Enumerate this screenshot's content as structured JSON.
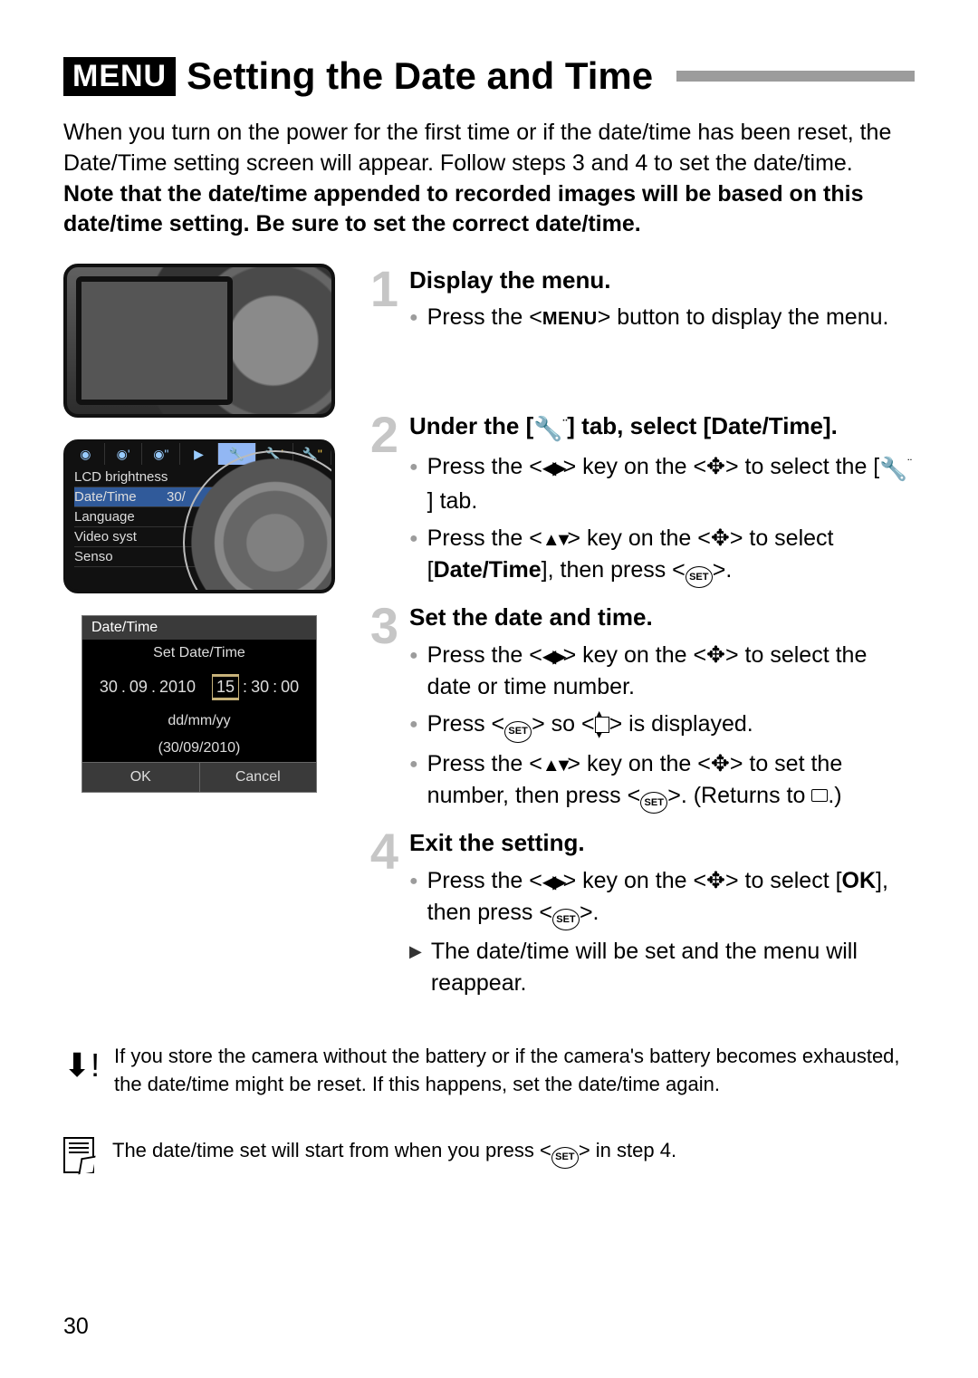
{
  "header": {
    "menu_badge": "MENU",
    "title": "Setting the Date and Time"
  },
  "intro": {
    "p1": "When you turn on the power for the first time or if the date/time has been reset, the Date/Time setting screen will appear. Follow steps 3 and 4 to set the date/time.",
    "p2_bold": "Note that the date/time appended to recorded images will be based on this date/time setting. Be sure to set the correct date/time."
  },
  "menu_thumb": {
    "lcd": "LCD brightness",
    "datetime": "Date/Time",
    "datetime_val": "30/",
    "language": "Language",
    "video": "Video syst",
    "sensor": "Senso"
  },
  "datetime_thumb": {
    "header": "Date/Time",
    "set_label": "Set Date/Time",
    "d": "30",
    "m": "09",
    "y": "2010",
    "h": "15",
    "min": "30",
    "s": "00",
    "format": "dd/mm/yy",
    "paren": "(30/09/2010)",
    "ok": "OK",
    "cancel": "Cancel"
  },
  "steps": {
    "s1": {
      "num": "1",
      "title": "Display the menu.",
      "b1a": "Press the <",
      "b1_menu": "MENU",
      "b1b": "> button to display the menu."
    },
    "s2": {
      "num": "2",
      "title_a": "Under the [",
      "title_b": "] tab, select [Date/Time].",
      "b1a": "Press the <",
      "b1b": "> key on the <",
      "b1c": "> to select the [",
      "b1d": "] tab.",
      "b2a": "Press the <",
      "b2b": "> key on the <",
      "b2c": "> to select [",
      "b2_bold": "Date/Time",
      "b2d": "], then press <",
      "b2e": ">."
    },
    "s3": {
      "num": "3",
      "title": "Set the date and time.",
      "b1a": "Press the <",
      "b1b": "> key on the <",
      "b1c": "> to select the date or time number.",
      "b2a": "Press <",
      "b2b": "> so <",
      "b2c": "> is displayed.",
      "b3a": "Press the <",
      "b3b": "> key on the <",
      "b3c": "> to set the number, then press <",
      "b3d": ">. (Returns to ",
      "b3e": ".)"
    },
    "s4": {
      "num": "4",
      "title": "Exit the setting.",
      "b1a": "Press the <",
      "b1b": "> key on the <",
      "b1c": "> to select [",
      "b1_bold": "OK",
      "b1d": "], then press <",
      "b1e": ">.",
      "b2": "The date/time will be set and the menu will reappear."
    }
  },
  "note1": "If you store the camera without the battery or if the camera's battery becomes exhausted, the date/time might be reset. If this happens, set the date/time again.",
  "note2a": "The date/time set will start from when you press <",
  "note2b": "> in step 4.",
  "page_number": "30"
}
